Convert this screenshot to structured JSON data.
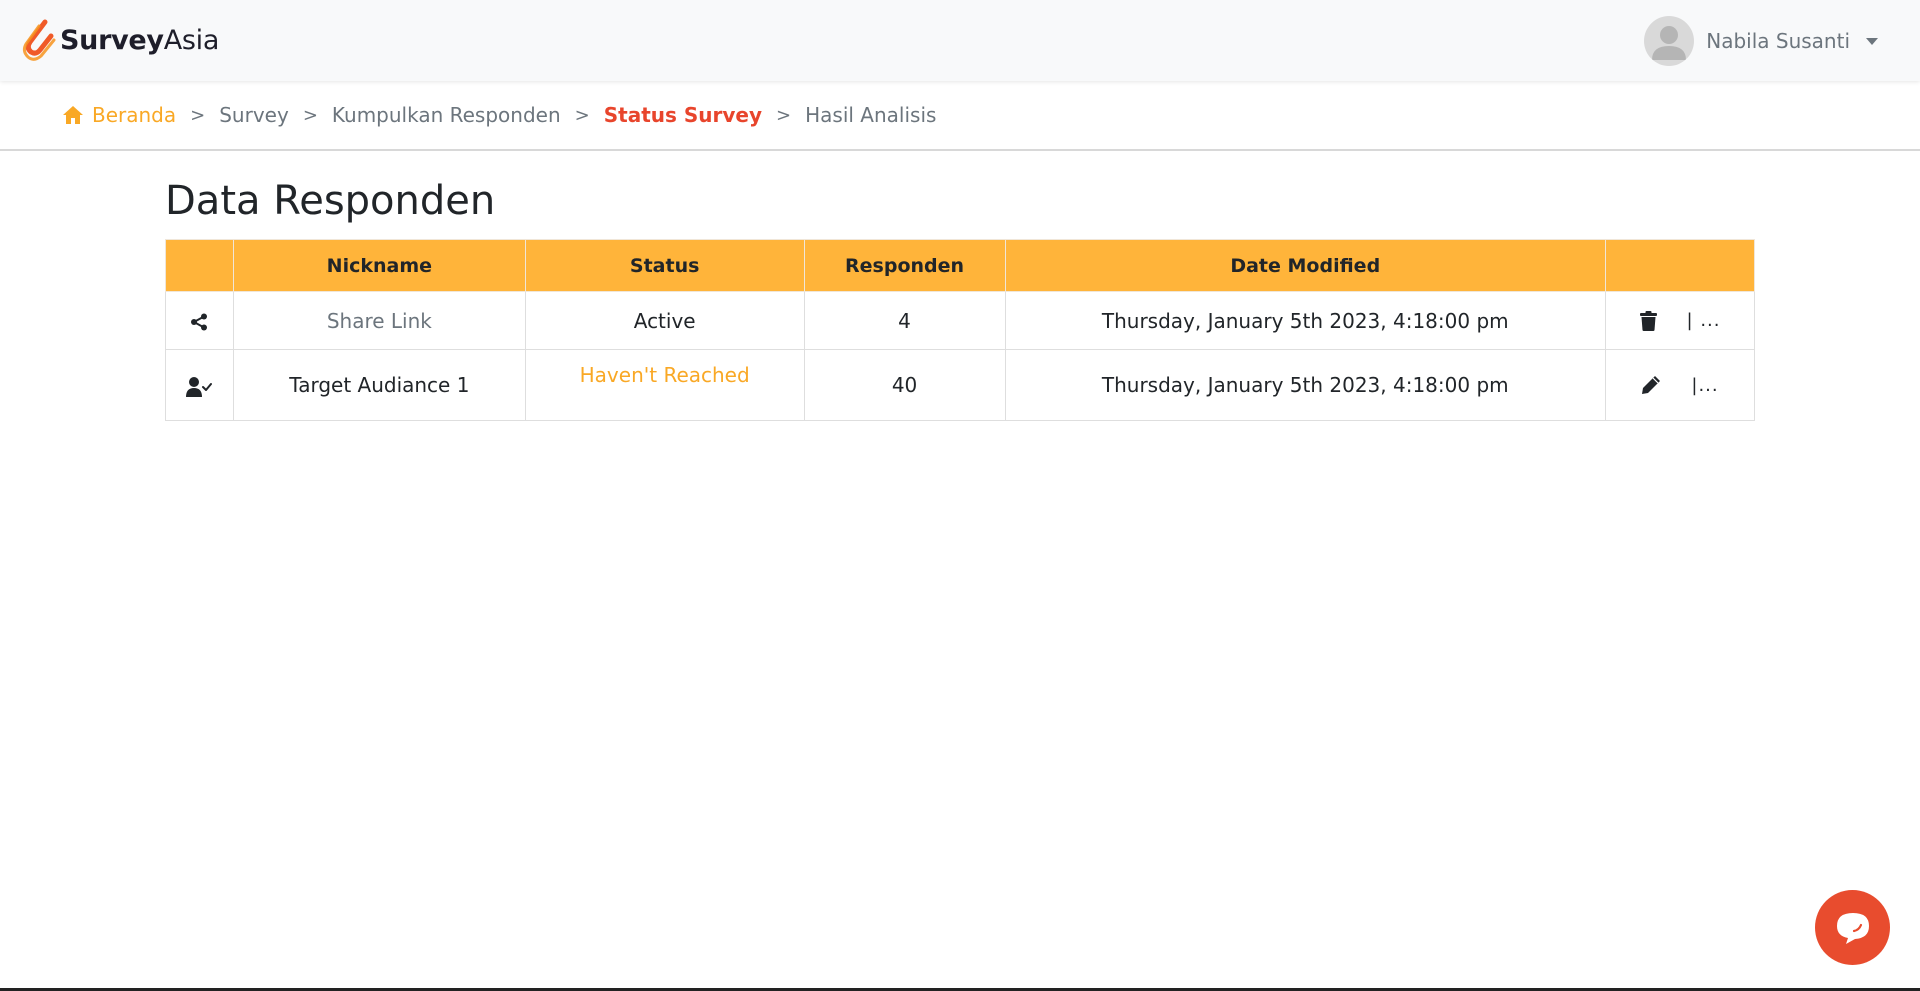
{
  "brand": {
    "name_bold": "Survey",
    "name_light": "Asia"
  },
  "user": {
    "name": "Nabila Susanti"
  },
  "breadcrumb": {
    "home": "Beranda",
    "items": [
      "Survey",
      "Kumpulkan Responden",
      "Status Survey",
      "Hasil Analisis"
    ],
    "separator": ">"
  },
  "page": {
    "title": "Data Responden"
  },
  "table": {
    "headers": [
      "",
      "Nickname",
      "Status",
      "Responden",
      "Date Modified",
      ""
    ],
    "rows": [
      {
        "icon": "share-icon",
        "nickname": "Share Link",
        "status": "Active",
        "responden": "4",
        "date_modified": "Thursday, January 5th 2023, 4:18:00 pm",
        "action_icon": "trash-icon",
        "more": "| ..."
      },
      {
        "icon": "user-check-icon",
        "nickname": "Target Audiance 1",
        "status": "Haven't Reached",
        "responden": "40",
        "date_modified": "Thursday, January 5th 2023, 4:18:00 pm",
        "action_icon": "pencil-icon",
        "more": "|..."
      }
    ]
  },
  "colors": {
    "header_bg": "#ffb43a",
    "accent_orange": "#f9a825",
    "accent_red": "#e8452c",
    "chat_button": "#e84c2e"
  }
}
